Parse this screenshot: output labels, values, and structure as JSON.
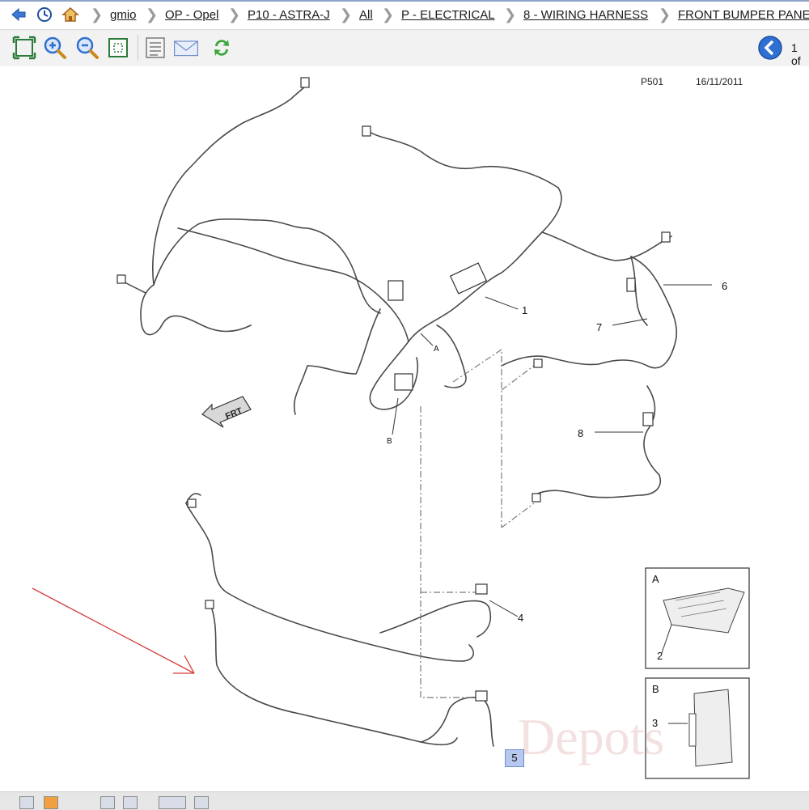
{
  "breadcrumb": {
    "items": [
      "gmio",
      "OP - Opel",
      "P10 - ASTRA-J",
      "All",
      "P - ELECTRICAL",
      "8 - WIRING HARNESS",
      "FRONT BUMPER PANE"
    ]
  },
  "toolbar": {
    "pager_text": "1 of"
  },
  "diagram": {
    "page_code": "P501",
    "date": "16/11/2011",
    "frt_label": "FRT",
    "callouts": [
      "1",
      "2",
      "3",
      "4",
      "5",
      "6",
      "7",
      "8"
    ],
    "detail_a_label": "A",
    "detail_b_label": "B",
    "harness_point_a": "A",
    "harness_point_b": "B",
    "selected_callout": "5",
    "watermark": "Depots"
  },
  "colors": {
    "accent": "#2f6fd1",
    "annotation_arrow": "#d43a3a",
    "selected_badge": "#b7c8ef"
  }
}
